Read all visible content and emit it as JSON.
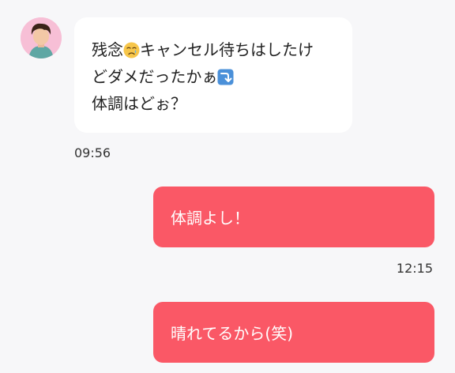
{
  "incoming": {
    "avatar_icon": "user-avatar-icon",
    "line1_part1": "残念",
    "line1_emoji": "crying-face-emoji",
    "line1_part2": "キャンセル待ちはしたけ",
    "line2_part1": "どダメだったかぁ",
    "line2_emoji": "arrow-down-right-emoji",
    "line3": "体調はどぉ？",
    "time": "09:56"
  },
  "outgoing": [
    {
      "text": "体調よし！",
      "time": "12:15"
    },
    {
      "text": "晴れてるから(笑)"
    }
  ],
  "colors": {
    "background": "#f7f7f9",
    "incoming_bubble": "#ffffff",
    "outgoing_bubble": "#fa5866",
    "avatar_bg": "#f7bfd6"
  }
}
